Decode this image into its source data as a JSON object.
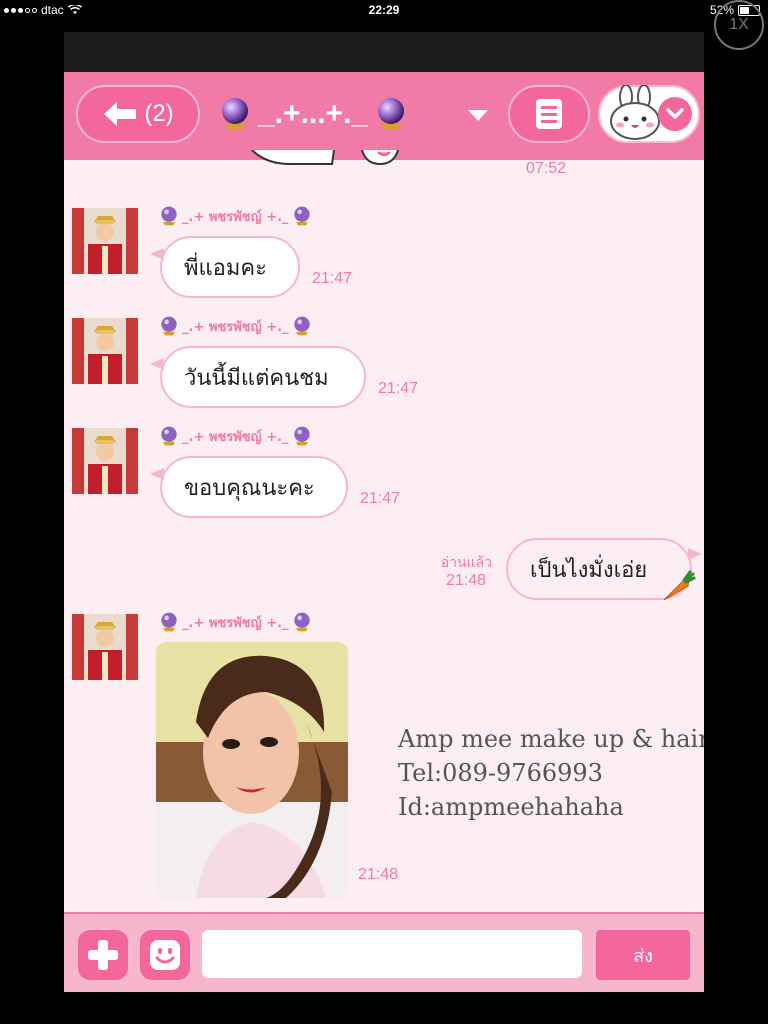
{
  "status_bar": {
    "carrier": "dtac",
    "time": "22:29",
    "battery": "52%",
    "battery_level": 0.52
  },
  "zoom_badge": "1X",
  "header": {
    "back_count": "(2)",
    "chat_title": "_.+...+._",
    "icons": {
      "back": "back-arrow-icon",
      "title_left": "crystal-ball-icon",
      "title_right": "crystal-ball-icon",
      "dropdown": "caret-down-icon",
      "menu": "notes-menu-icon",
      "sticker": "bunny-sticker-icon",
      "sticker_chevron": "chevron-down-icon"
    }
  },
  "chat": {
    "partial_time": "07:52",
    "messages": [
      {
        "sender": "_.+ พชรพัชญ์ +._",
        "text": "พี่แอมคะ",
        "time": "21:47"
      },
      {
        "sender": "_.+ พชรพัชญ์ +._",
        "text": "วันนี้มีแต่คนชม",
        "time": "21:47"
      },
      {
        "sender": "_.+ พชรพัชญ์ +._",
        "text": "ขอบคุณนะคะ",
        "time": "21:47"
      }
    ],
    "outgoing": {
      "read_label": "อ่านแล้ว",
      "time": "21:48",
      "text": "เป็นไงมั่งเอ่ย",
      "emoji": "carrot-icon"
    },
    "photo_message": {
      "sender": "_.+ พชรพัชญ์ +._",
      "time": "21:48",
      "overlay_lines": [
        "Amp mee make up & hair",
        "Tel:089-9766993",
        "Id:ampmeehahaha"
      ]
    }
  },
  "input_bar": {
    "placeholder": "",
    "send_label": "ส่ง",
    "icons": {
      "add": "plus-icon",
      "emoji": "smiley-icon"
    }
  },
  "colors": {
    "accent": "#f27aa6",
    "button": "#f3679b",
    "background": "#fdeef4"
  }
}
